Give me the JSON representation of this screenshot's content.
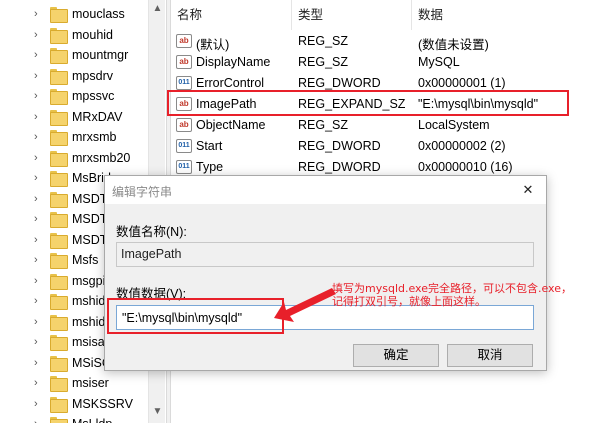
{
  "tree": {
    "items": [
      {
        "label": "mouclass"
      },
      {
        "label": "mouhid"
      },
      {
        "label": "mountmgr"
      },
      {
        "label": "mpsdrv"
      },
      {
        "label": "mpssvc"
      },
      {
        "label": "MRxDAV"
      },
      {
        "label": "mrxsmb"
      },
      {
        "label": "mrxsmb20"
      },
      {
        "label": "MsBridge"
      },
      {
        "label": "MSDTC"
      },
      {
        "label": "MSDTC"
      },
      {
        "label": "MSDTC"
      },
      {
        "label": "Msfs"
      },
      {
        "label": "msgpi"
      },
      {
        "label": "mshid"
      },
      {
        "label": "mshid"
      },
      {
        "label": "msisa"
      },
      {
        "label": "MSiSCSI"
      },
      {
        "label": "msiser"
      },
      {
        "label": "MSKSSRV"
      },
      {
        "label": "MsLldp"
      }
    ],
    "scroll_up": "▲",
    "scroll_down": "▼",
    "chevron": "›"
  },
  "values": {
    "headers": {
      "name": "名称",
      "type": "类型",
      "data": "数据"
    },
    "rows": [
      {
        "icon": "ab",
        "name": "(默认)",
        "type": "REG_SZ",
        "data": "(数值未设置)"
      },
      {
        "icon": "ab",
        "name": "DisplayName",
        "type": "REG_SZ",
        "data": "MySQL"
      },
      {
        "icon": "bin",
        "name": "ErrorControl",
        "type": "REG_DWORD",
        "data": "0x00000001 (1)"
      },
      {
        "icon": "ab",
        "name": "ImagePath",
        "type": "REG_EXPAND_SZ",
        "data": "\"E:\\mysql\\bin\\mysqld\""
      },
      {
        "icon": "ab",
        "name": "ObjectName",
        "type": "REG_SZ",
        "data": "LocalSystem"
      },
      {
        "icon": "bin",
        "name": "Start",
        "type": "REG_DWORD",
        "data": "0x00000002 (2)"
      },
      {
        "icon": "bin",
        "name": "Type",
        "type": "REG_DWORD",
        "data": "0x00000010 (16)"
      }
    ]
  },
  "dialog": {
    "title": "编辑字符串",
    "close": "✕",
    "name_label": "数值名称(N):",
    "name_value": "ImagePath",
    "data_label": "数值数据(V):",
    "data_value": "\"E:\\mysql\\bin\\mysqld\"",
    "ok": "确定",
    "cancel": "取消"
  },
  "annotation": {
    "line1": "填写为mysqld.exe完全路径，可以不包含.exe，",
    "line2": "记得打双引号，就像上面这样。",
    "color": "#e8202a"
  }
}
